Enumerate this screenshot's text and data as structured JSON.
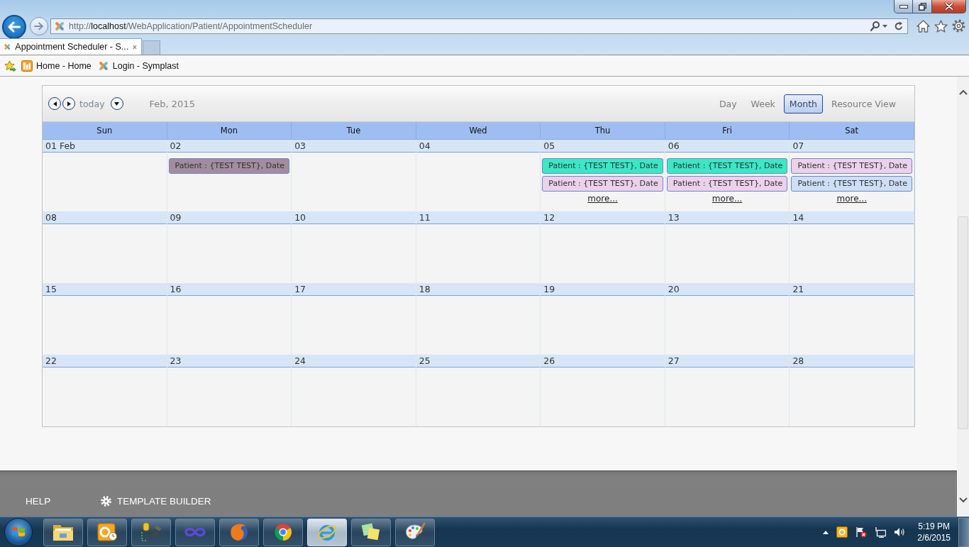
{
  "browser": {
    "url": "http://**localhost**/WebApplication/Patient/AppointmentScheduler",
    "tabs": [
      {
        "label": "Appointment Scheduler - S...",
        "selected": true
      }
    ],
    "favorites": [
      {
        "label": "Home - Home"
      },
      {
        "label": "Login - Symplast"
      }
    ]
  },
  "calendar": {
    "today": "today",
    "title": "Feb, 2015",
    "views": [
      {
        "label": "Day",
        "selected": false
      },
      {
        "label": "Week",
        "selected": false
      },
      {
        "label": "Month",
        "selected": true
      },
      {
        "label": "Resource View",
        "selected": false
      }
    ],
    "weekdays": [
      "Sun",
      "Mon",
      "Tue",
      "Wed",
      "Thu",
      "Fri",
      "Sat"
    ],
    "weeks": [
      {
        "days": [
          {
            "date": "01 Feb"
          },
          {
            "date": "02",
            "events": [
              {
                "text": "Patient : {TEST TEST}, Date",
                "color": "#a28d9f"
              }
            ]
          },
          {
            "date": "03"
          },
          {
            "date": "04"
          },
          {
            "date": "05",
            "events": [
              {
                "text": "Patient : {TEST TEST}, Date",
                "color": "#3ae8c5"
              },
              {
                "text": "Patient : {TEST TEST}, Date",
                "color": "#ecd1ea"
              }
            ],
            "more": "more..."
          },
          {
            "date": "06",
            "events": [
              {
                "text": "Patient : {TEST TEST}, Date",
                "color": "#3ae8c5"
              },
              {
                "text": "Patient : {TEST TEST}, Date",
                "color": "#ecd1ea"
              }
            ],
            "more": "more..."
          },
          {
            "date": "07",
            "events": [
              {
                "text": "Patient : {TEST TEST}, Date",
                "color": "#ecd1ea"
              },
              {
                "text": "Patient : {TEST TEST}, Date",
                "color": "#cddff5"
              }
            ],
            "more": "more..."
          }
        ]
      },
      {
        "days": [
          {
            "date": "08"
          },
          {
            "date": "09"
          },
          {
            "date": "10"
          },
          {
            "date": "11"
          },
          {
            "date": "12"
          },
          {
            "date": "13"
          },
          {
            "date": "14"
          }
        ]
      },
      {
        "days": [
          {
            "date": "15"
          },
          {
            "date": "16"
          },
          {
            "date": "17"
          },
          {
            "date": "18"
          },
          {
            "date": "19"
          },
          {
            "date": "20"
          },
          {
            "date": "21"
          }
        ]
      },
      {
        "days": [
          {
            "date": "22"
          },
          {
            "date": "23"
          },
          {
            "date": "24"
          },
          {
            "date": "25"
          },
          {
            "date": "26"
          },
          {
            "date": "27"
          },
          {
            "date": "28"
          }
        ]
      }
    ]
  },
  "footer": {
    "links": [
      {
        "label": "HELP",
        "kind": "plain"
      },
      {
        "label": "TEMPLATE BUILDER",
        "kind": "settings"
      }
    ]
  },
  "taskbar": {
    "buttons": [
      {
        "selected": false
      },
      {
        "selected": false
      },
      {
        "selected": false
      },
      {
        "selected": false
      },
      {
        "selected": false
      },
      {
        "selected": false
      },
      {
        "selected": true
      },
      {
        "selected": false
      },
      {
        "selected": false
      }
    ],
    "clock": {
      "time": "5:19 PM",
      "date": "2/6/2015"
    }
  }
}
